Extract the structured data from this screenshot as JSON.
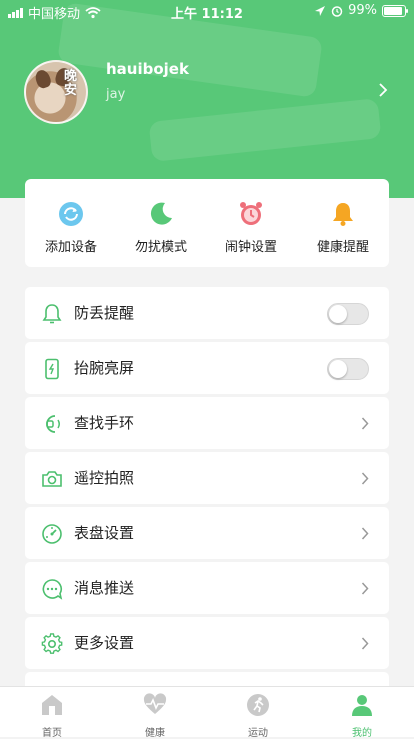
{
  "status_bar": {
    "carrier": "中国移动",
    "time": "上午 11:12",
    "battery": "99%"
  },
  "profile": {
    "username": "hauibojek",
    "nickname": "jay",
    "avatar_caption": "晚安"
  },
  "quick_actions": [
    {
      "label": "添加设备",
      "icon": "refresh-device-icon",
      "color": "#5cc0e8"
    },
    {
      "label": "勿扰模式",
      "icon": "moon-icon",
      "color": "#58c878"
    },
    {
      "label": "闹钟设置",
      "icon": "alarm-clock-icon",
      "color": "#ee6f7a"
    },
    {
      "label": "健康提醒",
      "icon": "bell-icon",
      "color": "#f5a623"
    }
  ],
  "settings": [
    {
      "label": "防丢提醒",
      "icon": "bell-outline-icon",
      "control": "toggle",
      "value": false
    },
    {
      "label": "抬腕亮屏",
      "icon": "wrist-screen-icon",
      "control": "toggle",
      "value": false
    },
    {
      "label": "查找手环",
      "icon": "find-band-icon",
      "control": "chevron"
    },
    {
      "label": "遥控拍照",
      "icon": "camera-icon",
      "control": "chevron"
    },
    {
      "label": "表盘设置",
      "icon": "dial-icon",
      "control": "chevron"
    },
    {
      "label": "消息推送",
      "icon": "message-icon",
      "control": "chevron"
    },
    {
      "label": "更多设置",
      "icon": "gear-icon",
      "control": "chevron"
    }
  ],
  "tab_bar": {
    "tabs": [
      {
        "label": "首页",
        "icon": "home-icon"
      },
      {
        "label": "健康",
        "icon": "heart-icon"
      },
      {
        "label": "运动",
        "icon": "runner-icon"
      },
      {
        "label": "我的",
        "icon": "person-icon"
      }
    ],
    "active": "我的"
  },
  "colors": {
    "brand": "#58c878",
    "icon_outline": "#4cbf6e",
    "background": "#f3f3f3"
  }
}
